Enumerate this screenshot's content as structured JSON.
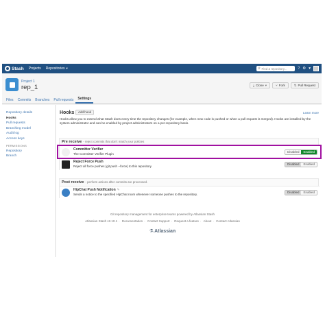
{
  "nav": {
    "brand": "Stash",
    "projects": "Projects",
    "repositories": "Repositories",
    "search_placeholder": "Find a repository..."
  },
  "header": {
    "project": "Project 1",
    "repo": "rep_1",
    "clone": "Clone",
    "fork": "Fork",
    "pull_request": "Pull Request"
  },
  "tabs": [
    "Files",
    "Commits",
    "Branches",
    "Pull requests",
    "Settings"
  ],
  "sidebar": {
    "items": [
      "Repository details",
      "Hooks",
      "Pull requests",
      "Branching model",
      "Audit log",
      "Access keys"
    ],
    "permissions_heading": "PERMISSIONS",
    "permission_items": [
      "Repository",
      "Branch"
    ]
  },
  "main": {
    "title": "Hooks",
    "add_hook": "Add hook",
    "learn_more": "Learn more",
    "description": "Hooks allow you to extend what Stash does every time the repository changes (for example, when new code is pushed or when a pull request is merged). Hooks are installed by the system administrator and can be enabled by project administrators on a per-repository basis.",
    "pre_receive": {
      "title": "Pre receive",
      "subtitle": "- reject commits that don't match your policies",
      "hooks": [
        {
          "name": "Committer Verifier",
          "desc": "The Committer Verifier Plugin",
          "state": "Enabled"
        },
        {
          "name": "Reject Force Push",
          "desc": "Reject all force pushes (git push --force) to this repository",
          "state": "Disabled"
        }
      ]
    },
    "post_receive": {
      "title": "Post receive",
      "subtitle": "- perform actions after commits are processed.",
      "hooks": [
        {
          "name": "HipChat Push Notification",
          "desc": "Sends a notice to the specified HipChat room whenever someone pushes to the repository.",
          "state": "Disabled"
        }
      ]
    },
    "toggle_disabled": "Disabled",
    "toggle_enabled": "Enabled"
  },
  "footer": {
    "line1": "Git repository management for enterprise teams powered by Atlassian Stash",
    "links": [
      "Atlassian Stash v2.10.1",
      "Documentation",
      "Contact Support",
      "Request a feature",
      "About",
      "Contact Atlassian"
    ],
    "logo": "Atlassian"
  },
  "colors": {
    "nav_bg": "#205081",
    "link": "#3b73af",
    "enabled": "#14892c",
    "highlight": "#a010a0"
  }
}
